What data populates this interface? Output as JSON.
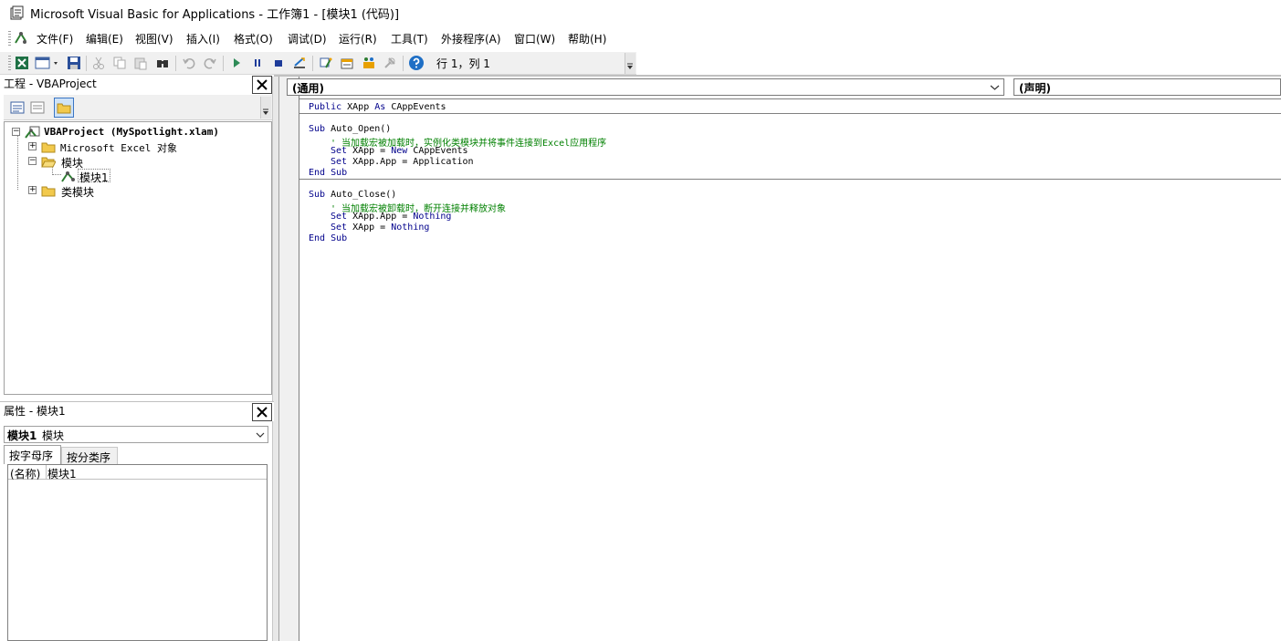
{
  "window": {
    "title": "Microsoft Visual Basic for Applications - 工作簿1 - [模块1 (代码)]"
  },
  "menubar": {
    "items": [
      "文件(F)",
      "编辑(E)",
      "视图(V)",
      "插入(I)",
      "格式(O)",
      "调试(D)",
      "运行(R)",
      "工具(T)",
      "外接程序(A)",
      "窗口(W)",
      "帮助(H)"
    ]
  },
  "toolbar": {
    "cursor_position": "行 1，列 1"
  },
  "project_pane": {
    "title": "工程 - VBAProject",
    "tree": {
      "root": "VBAProject (MySpotlight.xlam)",
      "excel_objects": "Microsoft Excel 对象",
      "modules_folder": "模块",
      "module1": "模块1",
      "class_modules": "类模块"
    }
  },
  "properties_pane": {
    "title": "属性 - 模块1",
    "object_name": "模块1",
    "object_type": "模块",
    "tabs": [
      "按字母序",
      "按分类序"
    ],
    "rows": [
      {
        "name": "(名称)",
        "value": "模块1"
      }
    ]
  },
  "code_window": {
    "object_combo": "(通用)",
    "procedure_combo": "(声明)",
    "lines": {
      "l1_kw": "Public",
      "l1_rest": " XApp ",
      "l1_kw2": "As",
      "l1_rest2": " CAppEvents",
      "l3_kw": "Sub",
      "l3_rest": " Auto_Open()",
      "l4_comment": "' 当加载宏被加载时，实例化类模块并将事件连接到Excel应用程序",
      "l5_kw": "Set",
      "l5_rest": " XApp = ",
      "l5_kw2": "New",
      "l5_rest2": " CAppEvents",
      "l6_kw": "Set",
      "l6_rest": " XApp.App = Application",
      "l7_kw": "End Sub",
      "l9_kw": "Sub",
      "l9_rest": " Auto_Close()",
      "l10_comment": "' 当加载宏被卸载时，断开连接并释放对象",
      "l11_kw": "Set",
      "l11_rest": " XApp.App = ",
      "l11_kw2": "Nothing",
      "l12_kw": "Set",
      "l12_rest": " XApp = ",
      "l12_kw2": "Nothing",
      "l13_kw": "End Sub"
    }
  },
  "colors": {
    "keyword": "#00008b",
    "comment": "#008000",
    "run_green": "#2e8b57",
    "stop_blue": "#1e3c9a",
    "help_blue": "#1f6fc5"
  }
}
